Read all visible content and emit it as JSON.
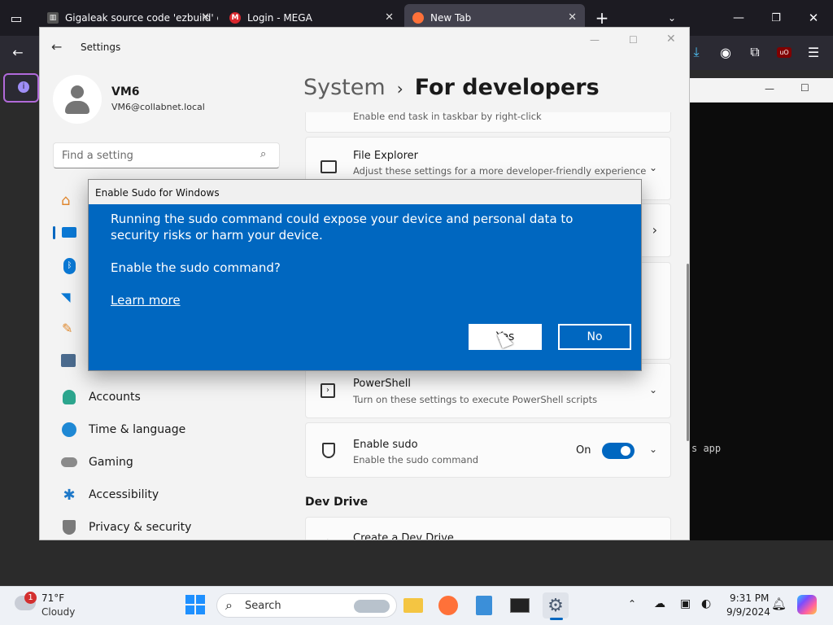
{
  "browser": {
    "tabs": [
      {
        "label": "Gigaleak source code 'ezbuild' c"
      },
      {
        "label": "Login - MEGA"
      },
      {
        "label": "New Tab"
      }
    ]
  },
  "terminal": {
    "text": "s app"
  },
  "settings": {
    "back_label": "Settings",
    "user": {
      "name": "VM6",
      "email": "VM6@collabnet.local"
    },
    "search_placeholder": "Find a setting",
    "breadcrumb": {
      "parent": "System",
      "separator": "›",
      "current": "For developers"
    },
    "sidebar": [
      {
        "label": "Accounts"
      },
      {
        "label": "Time & language"
      },
      {
        "label": "Gaming"
      },
      {
        "label": "Accessibility"
      },
      {
        "label": "Privacy & security"
      }
    ],
    "partial_top_text": "Enable end task in taskbar by right-click",
    "cards": [
      {
        "title": "File Explorer",
        "subtitle": "Adjust these settings for a more developer-friendly experience"
      },
      {
        "title": "PowerShell",
        "subtitle": "Turn on these settings to execute PowerShell scripts"
      },
      {
        "title": "Enable sudo",
        "subtitle": "Enable the sudo command",
        "toggle_label": "On"
      }
    ],
    "section_heading": "Dev Drive",
    "partial_bottom_title": "Create a Dev Drive"
  },
  "dialog": {
    "title": "Enable Sudo for Windows",
    "message": "Running the sudo command could expose your device and personal data to security risks or harm your device.",
    "question": "Enable the sudo command?",
    "link": "Learn more",
    "yes": "Yes",
    "no": "No"
  },
  "taskbar": {
    "weather": {
      "temp": "71°F",
      "condition": "Cloudy",
      "badge": "1"
    },
    "search_label": "Search",
    "time": "9:31 PM",
    "date": "9/9/2024"
  },
  "colors": {
    "accent": "#0067c0",
    "browser_bg": "#1c1b22"
  }
}
